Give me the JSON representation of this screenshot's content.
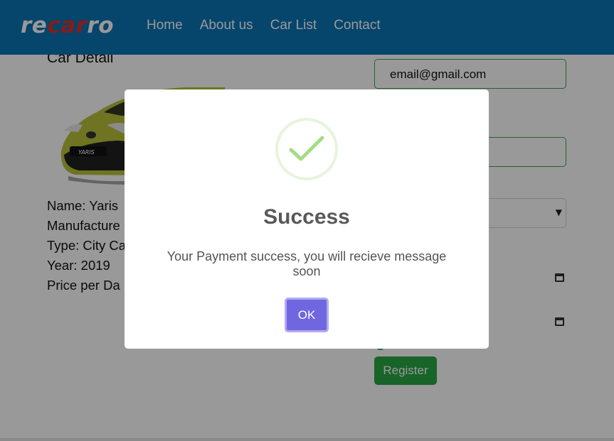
{
  "brand": {
    "logo_part1": "re",
    "logo_part2": "car",
    "logo_part3": "ro",
    "color_primary": "#0a74b5",
    "color_logo_accent": "#e0302b"
  },
  "nav": {
    "items": [
      "Home",
      "About us",
      "Car List",
      "Contact"
    ]
  },
  "car_detail": {
    "title": "Car Detail",
    "image_alt": "yellow Toyota Yaris",
    "rows": [
      "Name: Yaris",
      "Manufacture",
      "Type: City Ca",
      "Year: 2019",
      "Price per Da"
    ]
  },
  "form": {
    "email_value": "email@gmail.com",
    "register_label": "Register",
    "field_color": "#3aa356"
  },
  "modal": {
    "title": "Success",
    "message": "Your Payment success, you will recieve message soon",
    "ok_label": "OK",
    "icon": "check-icon",
    "ok_color": "#7066e0"
  }
}
